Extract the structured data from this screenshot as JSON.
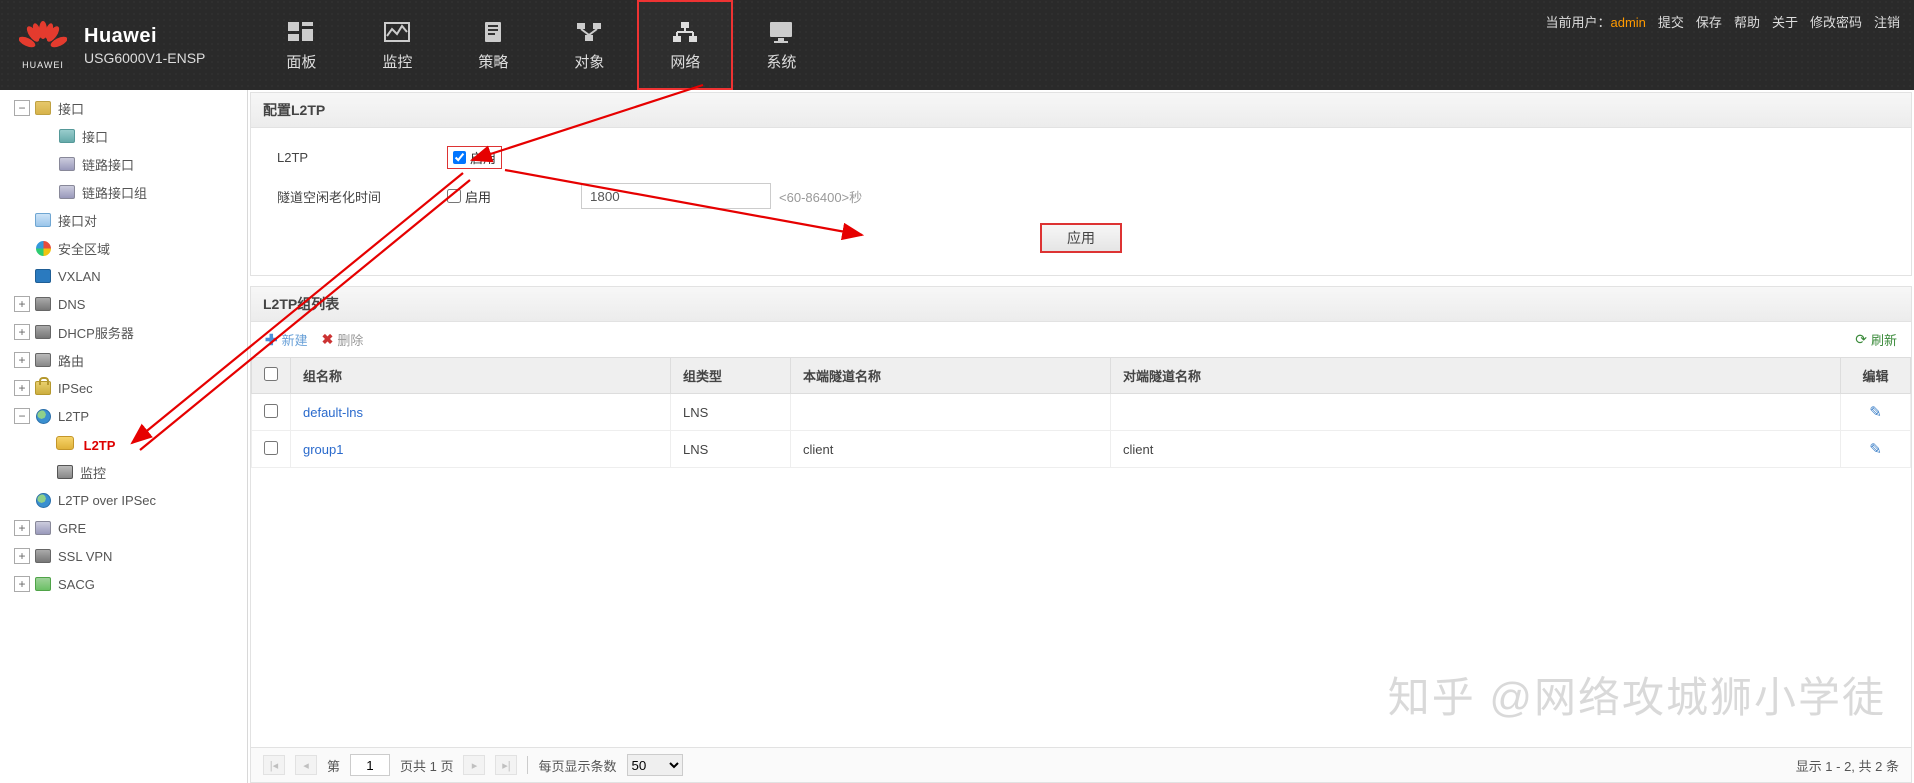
{
  "header": {
    "brand_name": "Huawei",
    "brand_model": "USG6000V1-ENSP",
    "logo_label": "HUAWEI",
    "nav": [
      {
        "label": "面板",
        "icon": "dashboard"
      },
      {
        "label": "监控",
        "icon": "monitor"
      },
      {
        "label": "策略",
        "icon": "policy"
      },
      {
        "label": "对象",
        "icon": "object"
      },
      {
        "label": "网络",
        "icon": "network",
        "active": true
      },
      {
        "label": "系统",
        "icon": "system"
      }
    ],
    "top_right": {
      "current_user_label": "当前用户：",
      "username": "admin",
      "links": [
        "提交",
        "保存",
        "帮助",
        "关于",
        "修改密码",
        "注销"
      ]
    }
  },
  "sidebar": {
    "items": [
      {
        "label": "接口",
        "icon": "folder",
        "exp": "-",
        "level": 1,
        "children": [
          {
            "label": "接口",
            "icon": "nic",
            "level": 2
          },
          {
            "label": "链路接口",
            "icon": "link",
            "level": 2
          },
          {
            "label": "链路接口组",
            "icon": "link",
            "level": 2
          }
        ]
      },
      {
        "label": "接口对",
        "icon": "pair",
        "exp": "",
        "level": 1
      },
      {
        "label": "安全区域",
        "icon": "zone",
        "exp": "",
        "level": 1
      },
      {
        "label": "VXLAN",
        "icon": "vxlan",
        "exp": "",
        "level": 1
      },
      {
        "label": "DNS",
        "icon": "dns",
        "exp": "+",
        "level": 1
      },
      {
        "label": "DHCP服务器",
        "icon": "dhcp",
        "exp": "+",
        "level": 1
      },
      {
        "label": "路由",
        "icon": "route",
        "exp": "+",
        "level": 1
      },
      {
        "label": "IPSec",
        "icon": "lock",
        "exp": "+",
        "level": 1
      },
      {
        "label": "L2TP",
        "icon": "earth",
        "exp": "-",
        "level": 1,
        "children": [
          {
            "label": "L2TP",
            "icon": "l2tp",
            "level": 2,
            "selected": true
          },
          {
            "label": "监控",
            "icon": "monitor",
            "level": 2
          }
        ]
      },
      {
        "label": "L2TP over IPSec",
        "icon": "earth",
        "exp": "",
        "level": 1
      },
      {
        "label": "GRE",
        "icon": "link",
        "exp": "+",
        "level": 1
      },
      {
        "label": "SSL VPN",
        "icon": "sslvpn",
        "exp": "+",
        "level": 1
      },
      {
        "label": "SACG",
        "icon": "sacg",
        "exp": "+",
        "level": 1
      }
    ]
  },
  "config_panel": {
    "title": "配置L2TP",
    "l2tp_label": "L2TP",
    "enable_label": "启用",
    "idle_label": "隧道空闲老化时间",
    "idle_enable_label": "启用",
    "idle_value": "1800",
    "idle_hint": "<60-86400>秒",
    "apply_btn": "应用"
  },
  "list_panel": {
    "title": "L2TP组列表",
    "toolbar": {
      "new": "新建",
      "delete": "删除",
      "refresh": "刷新"
    },
    "columns": [
      "组名称",
      "组类型",
      "本端隧道名称",
      "对端隧道名称",
      "编辑"
    ],
    "rows": [
      {
        "name": "default-lns",
        "type": "LNS",
        "local": "",
        "peer": ""
      },
      {
        "name": "group1",
        "type": "LNS",
        "local": "client",
        "peer": "client"
      }
    ]
  },
  "pager": {
    "page_label_prefix": "第",
    "page_value": "1",
    "page_total_text": "页共 1 页",
    "page_size_label": "每页显示条数",
    "page_size": "50",
    "summary": "显示 1 - 2, 共 2 条"
  },
  "watermark": "知乎 @网络攻城狮小学徒"
}
